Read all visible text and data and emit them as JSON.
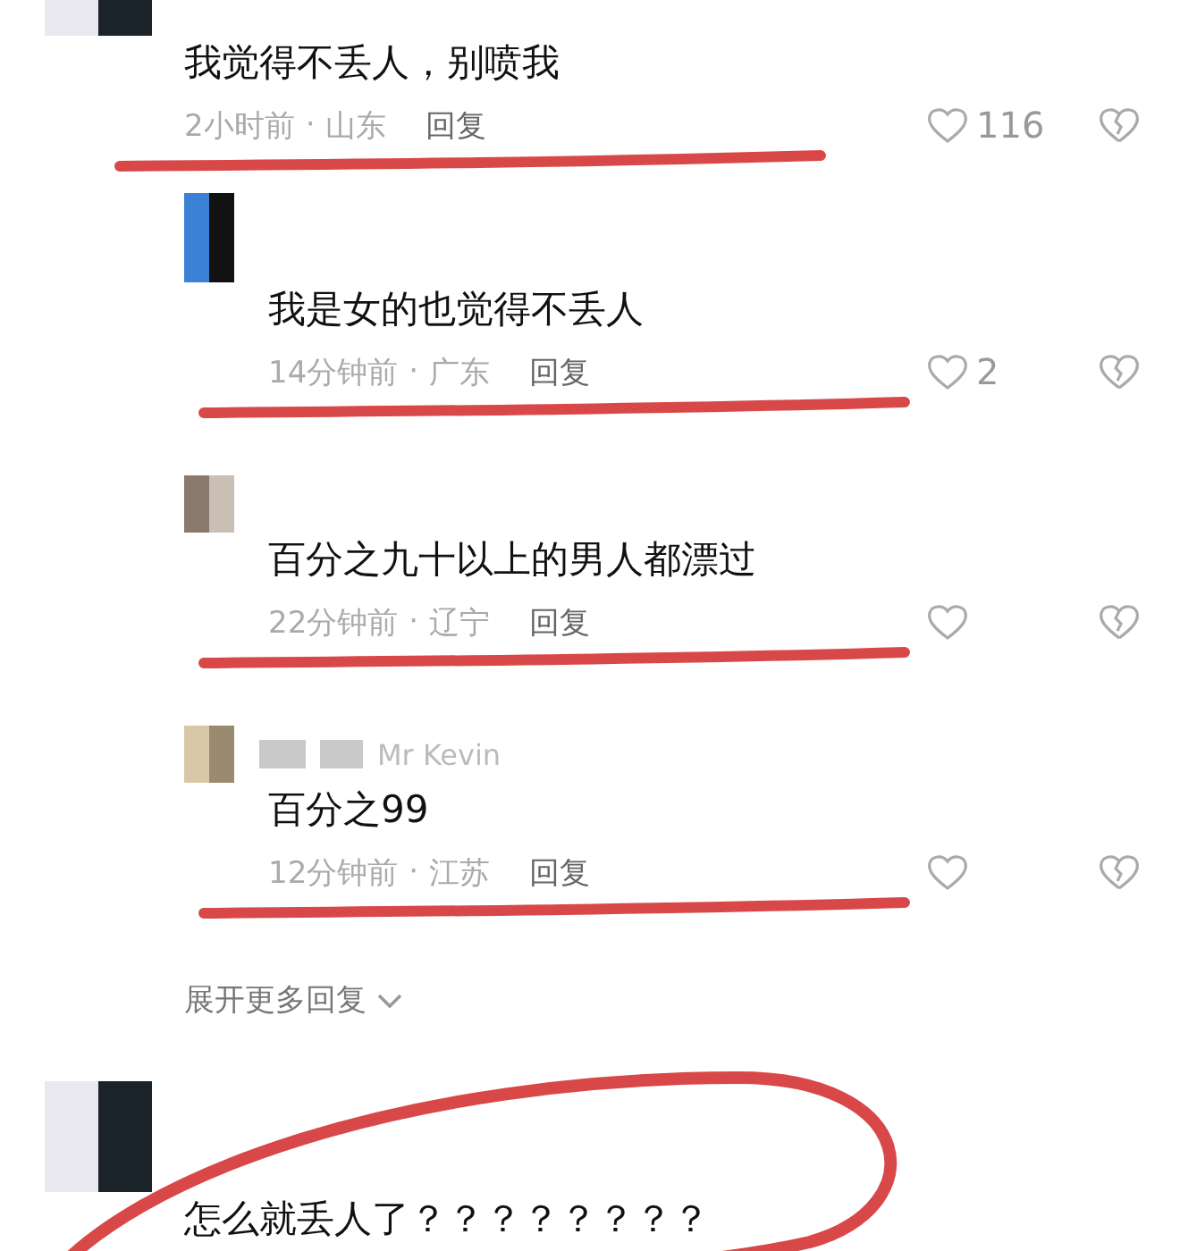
{
  "comments": [
    {
      "text": "我觉得不丢人，别喷我",
      "time": "2小时前",
      "separator": "·",
      "location": "山东",
      "reply_label": "回复",
      "likes": "116",
      "underlined": true,
      "replies": [
        {
          "text": "我是女的也觉得不丢人",
          "time": "14分钟前",
          "separator": "·",
          "location": "广东",
          "reply_label": "回复",
          "likes": "2",
          "underlined": true
        },
        {
          "text": "百分之九十以上的男人都漂过",
          "time": "22分钟前",
          "separator": "·",
          "location": "辽宁",
          "reply_label": "回复",
          "underlined": true
        },
        {
          "username": "Mr Kevin",
          "text": "百分之99",
          "time": "12分钟前",
          "separator": "·",
          "location": "江苏",
          "reply_label": "回复",
          "underlined": true
        }
      ],
      "expand_label": "展开更多回复"
    },
    {
      "text": "怎么就丢人了？？？？？？？？",
      "circled": true
    }
  ]
}
